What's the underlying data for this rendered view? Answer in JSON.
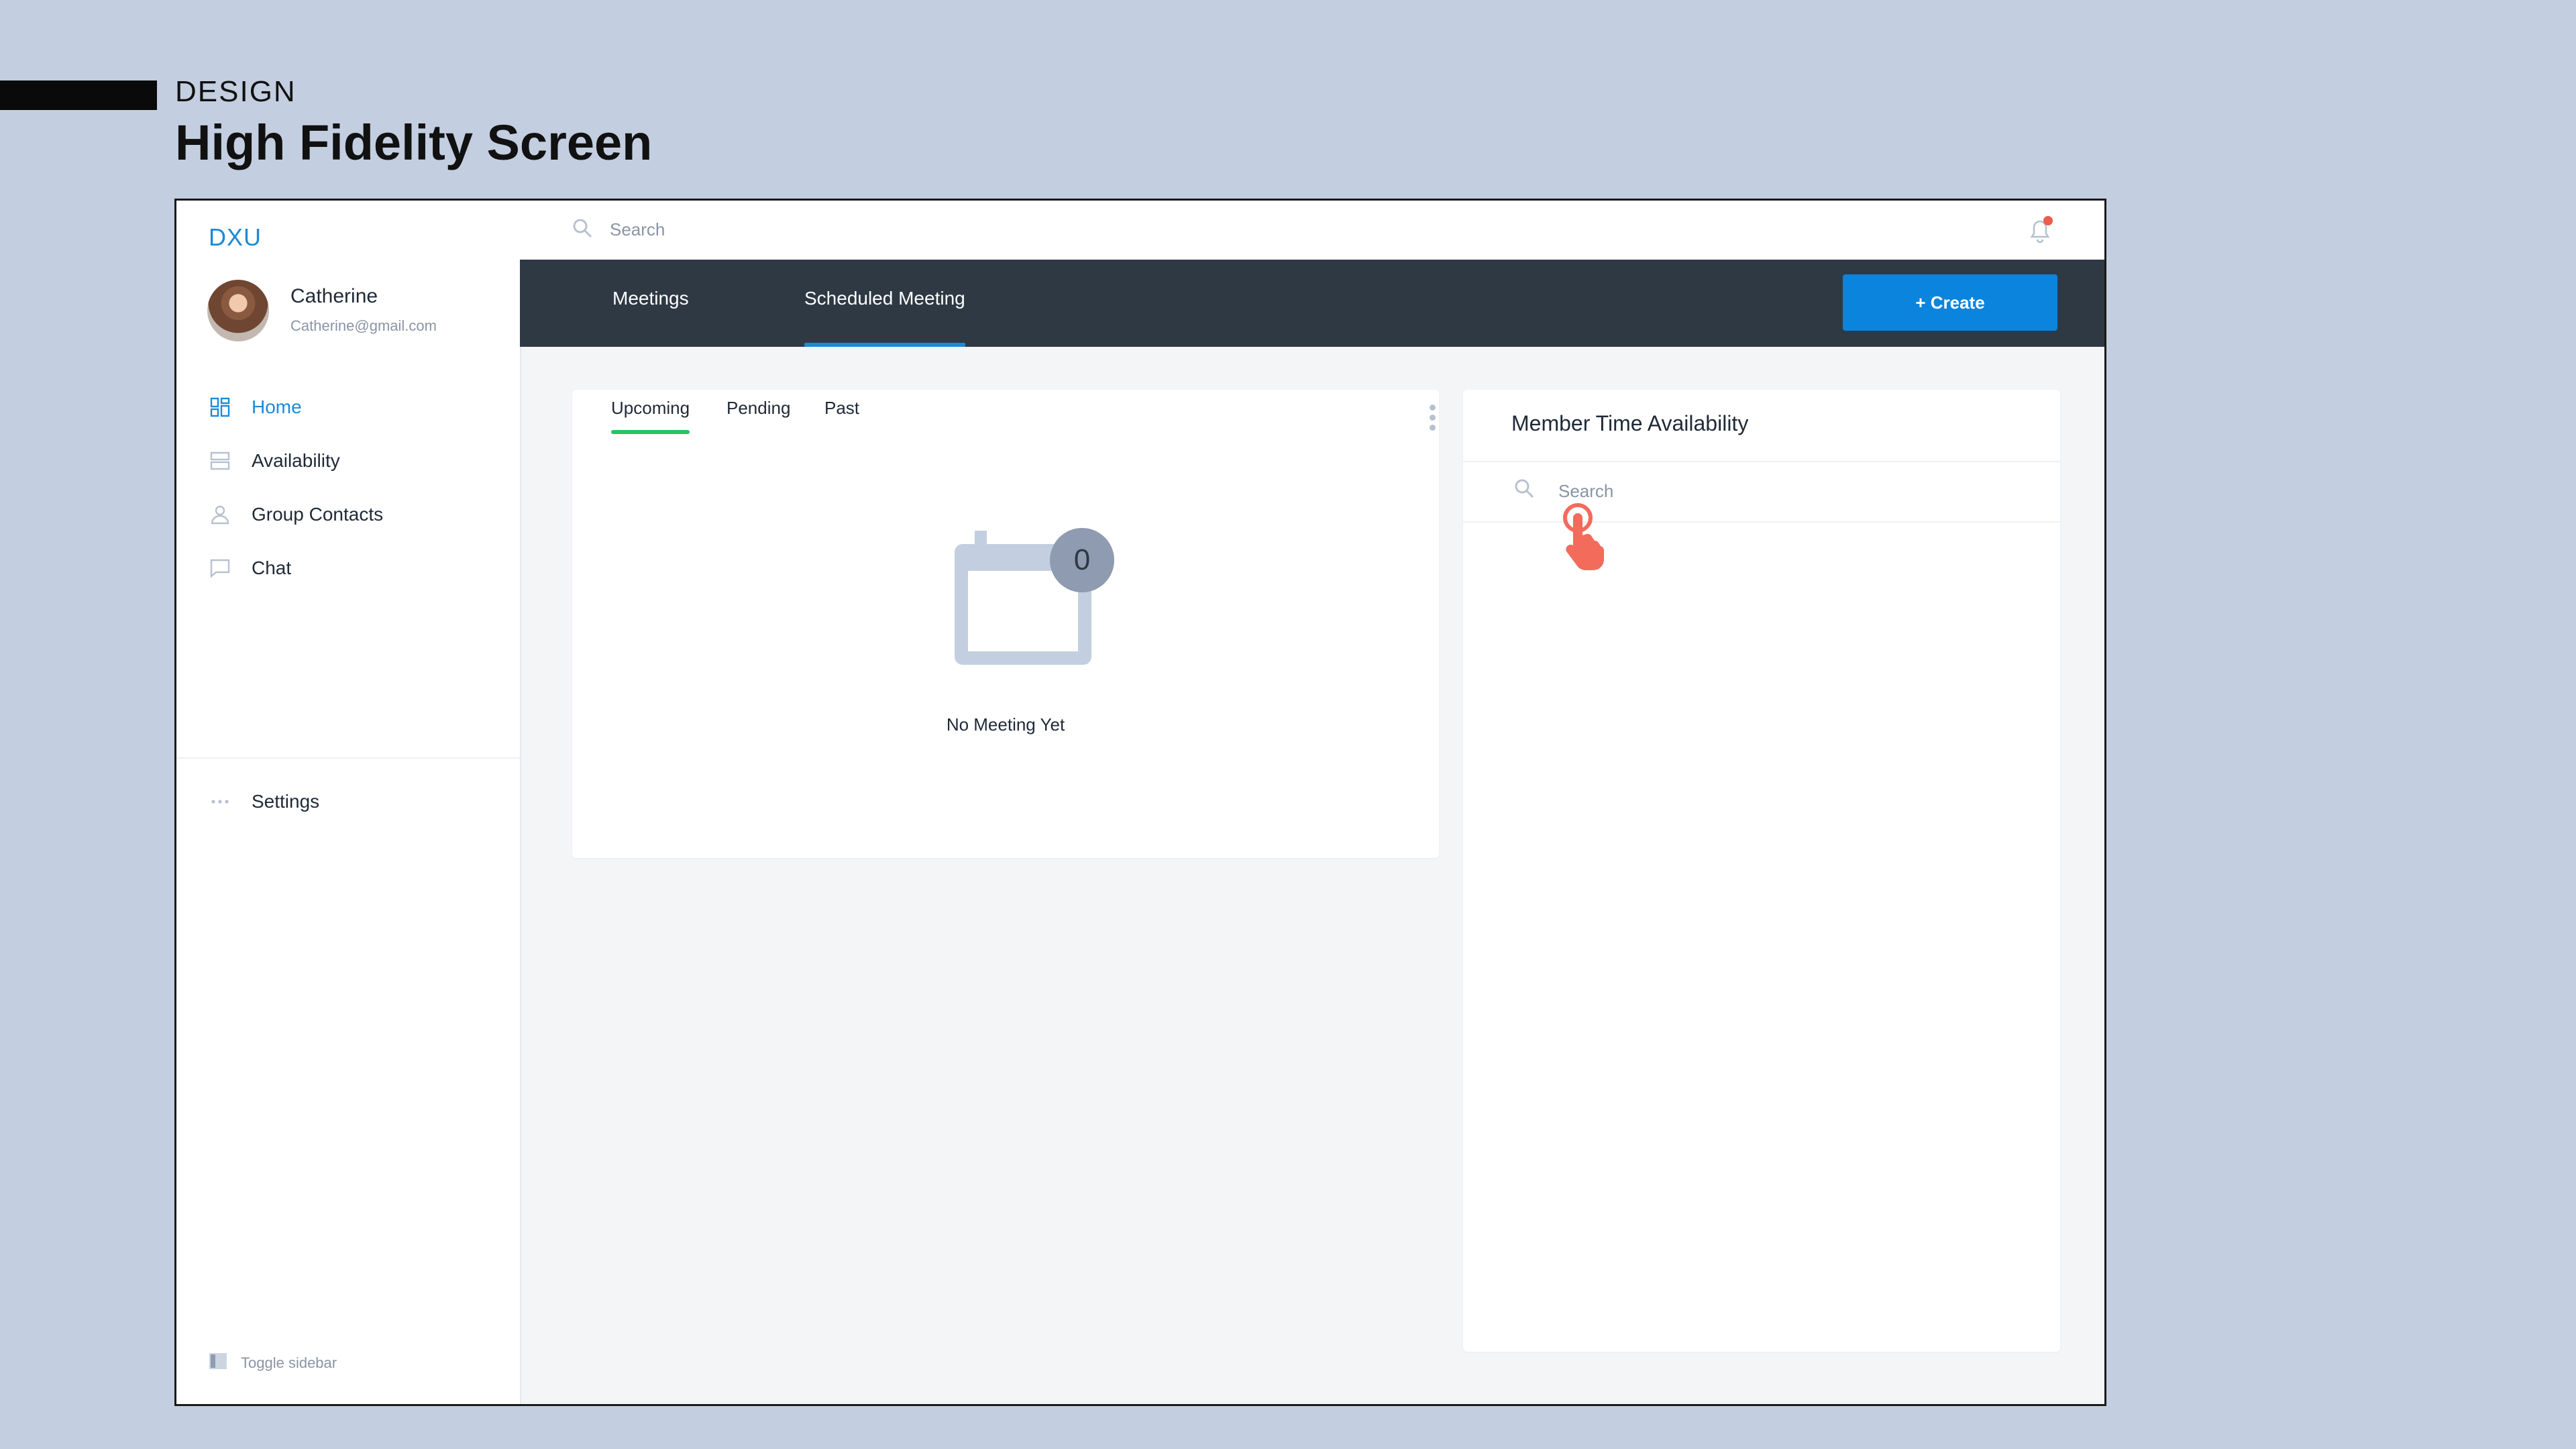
{
  "slide": {
    "kicker": "DESIGN",
    "title": "High Fidelity Screen"
  },
  "sidebar": {
    "logo": "DXU",
    "user": {
      "name": "Catherine",
      "email": "Catherine@gmail.com"
    },
    "items": [
      {
        "label": "Home",
        "icon": "grid-icon",
        "active": true
      },
      {
        "label": "Availability",
        "icon": "list-icon",
        "active": false
      },
      {
        "label": "Group Contacts",
        "icon": "user-icon",
        "active": false
      },
      {
        "label": "Chat",
        "icon": "chat-icon",
        "active": false
      }
    ],
    "settings_label": "Settings",
    "toggle_label": "Toggle sidebar"
  },
  "topbar": {
    "search_placeholder": "Search",
    "notification_dot": true
  },
  "tabs": [
    {
      "label": "Meetings",
      "active": false
    },
    {
      "label": "Scheduled Meeting",
      "active": true
    }
  ],
  "create_label": "+ Create",
  "meetings": {
    "subtabs": [
      {
        "label": "Upcoming",
        "active": true
      },
      {
        "label": "Pending",
        "active": false
      },
      {
        "label": "Past",
        "active": false
      }
    ],
    "count": "0",
    "empty_text": "No Meeting Yet"
  },
  "availability": {
    "title": "Member Time Availability",
    "search_placeholder": "Search"
  },
  "colors": {
    "accent": "#1b8ad6",
    "button": "#0b84dd",
    "tabbar": "#2f3944",
    "subtab_active": "#22c55e",
    "notification": "#ef5b4c",
    "pointer": "#f26b5b",
    "page_bg": "#c3cfe0"
  }
}
